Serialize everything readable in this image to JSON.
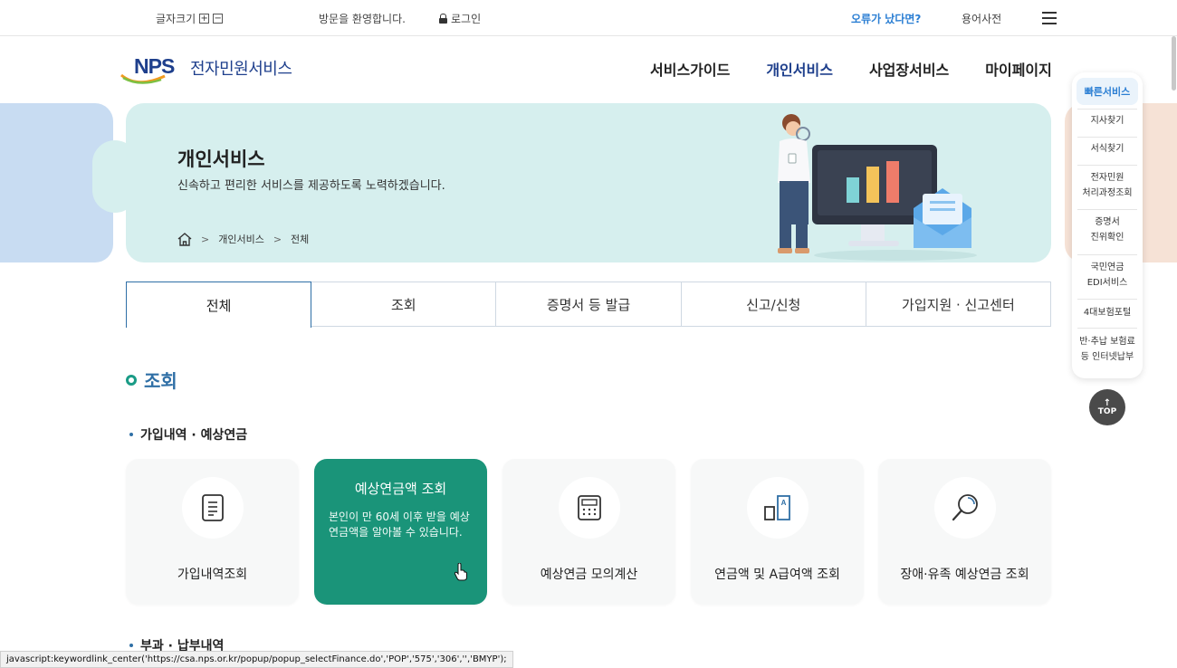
{
  "topbar": {
    "font_size_label": "글자크기",
    "font_plus": "+",
    "font_minus": "−",
    "welcome": "방문을 환영합니다.",
    "login": "로그인",
    "error_report": "오류가 났다면?",
    "glossary": "용어사전"
  },
  "header": {
    "logo_mark": "NPS",
    "logo_text": "전자민원서비스",
    "nav": [
      "서비스가이드",
      "개인서비스",
      "사업장서비스",
      "마이페이지"
    ],
    "active_nav": "개인서비스"
  },
  "banner": {
    "title": "개인서비스",
    "subtitle": "신속하고 편리한 서비스를 제공하도록 노력하겠습니다.",
    "breadcrumb": [
      "개인서비스",
      "전체"
    ]
  },
  "tabs": [
    "전체",
    "조회",
    "증명서 등 발급",
    "신고/신청",
    "가입지원 · 신고센터"
  ],
  "active_tab": "전체",
  "section": {
    "title": "조회",
    "group1": "가입내역 · 예상연금",
    "group2": "부과 · 납부내역"
  },
  "cards": [
    {
      "label": "가입내역조회",
      "icon": "document-icon"
    },
    {
      "title": "예상연금액 조회",
      "desc": "본인이 만 60세 이후 받을 예상연금액을 알아볼 수 있습니다.",
      "icon": "none"
    },
    {
      "label": "예상연금 모의계산",
      "icon": "calculator-icon"
    },
    {
      "label": "연금액 및 A급여액 조회",
      "icon": "chart-a-icon"
    },
    {
      "label": "장애·유족 예상연금 조회",
      "icon": "magnifier-icon"
    }
  ],
  "quick_menu": {
    "title": "빠른서비스",
    "items": [
      "지사찾기",
      "서식찾기",
      "전자민원\n처리과정조회",
      "증명서\n진위확인",
      "국민연금\nEDI서비스",
      "4대보험포털",
      "반·추납 보험료\n등 인터넷납부"
    ],
    "top": "TOP"
  },
  "status_bar": "javascript:keywordlink_center('https://csa.nps.or.kr/popup/popup_selectFinance.do','POP','575','306','','BMYP');",
  "colors": {
    "brand_blue": "#1e3f8c",
    "teal": "#1a9479",
    "banner_bg": "#d6efee"
  }
}
